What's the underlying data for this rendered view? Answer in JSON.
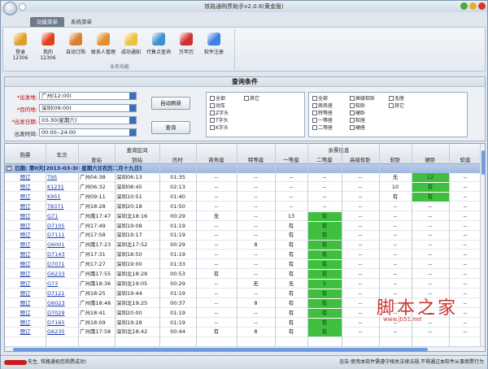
{
  "window": {
    "title": "铁路通购票助手v2.0.8(黄金版)"
  },
  "tabs": [
    "功能菜单",
    "系统菜单"
  ],
  "ribbon": {
    "buttons": [
      {
        "label": "登录12306",
        "icon": "user-login-icon",
        "color": "#e0a030"
      },
      {
        "label": "我的12306",
        "icon": "home-icon",
        "color": "#e04020"
      },
      {
        "label": "自动订购",
        "icon": "people-icon",
        "color": "#d88030"
      },
      {
        "label": "联系人管理",
        "icon": "contact-icon",
        "color": "#e09030"
      },
      {
        "label": "成功通知",
        "icon": "speech-bubble-icon",
        "color": "#f0c040"
      },
      {
        "label": "代售点查询",
        "icon": "search-document-icon",
        "color": "#4090d0"
      },
      {
        "label": "万年历",
        "icon": "calendar-icon",
        "color": "#d03030"
      },
      {
        "label": "软件注册",
        "icon": "flag-icon",
        "color": "#4080e0"
      }
    ],
    "group_label": "业务功能"
  },
  "query": {
    "title": "查询条件",
    "from_label": "*出发地:",
    "from_value": "广州(12:00)",
    "to_label": "*目的地:",
    "to_value": "深圳(09:00)",
    "date_label": "*出发日期:",
    "date_value": "03-30(星期六)",
    "time_label": "出发时间:",
    "time_value": "00:00--24:00",
    "auto_refresh": "自动刷新",
    "query_btn": "查询",
    "train_types": [
      "全部",
      "动车",
      "Z字头",
      "T字头",
      "K字头",
      "其它"
    ],
    "seat_types": [
      "全部",
      "商务座",
      "特等座",
      "一等座",
      "二等座",
      "高级软卧",
      "软卧",
      "硬卧",
      "软座",
      "硬座",
      "无座",
      "其它"
    ]
  },
  "grid": {
    "headers": {
      "buy": "购票",
      "train": "车次",
      "section": "查询区间",
      "from_st": "发站",
      "to_st": "到站",
      "duration": "历时",
      "ticket_info": "余票信息",
      "swz": "商务座",
      "tdz": "特等座",
      "ydz": "一等座",
      "edz": "二等座",
      "gjrw": "高级软卧",
      "rw": "软卧",
      "yw": "硬卧",
      "rz": "软座"
    },
    "group_text": "日期: 第0天[2013-03-30 星期六][农历二月十九日]",
    "green": "#3fbe3f",
    "rows": [
      {
        "buy": "预订",
        "train": "T95",
        "from": "广州04:38",
        "to": "深圳06:13",
        "dur": "01:35",
        "swz": "--",
        "tdz": "--",
        "ydz": "--",
        "edz": "--",
        "gjrw": "--",
        "rw": "无",
        "yw": "12",
        "rz": "--",
        "g": [
          "yw"
        ]
      },
      {
        "buy": "预订",
        "train": "K1231",
        "from": "广州06:32",
        "to": "深圳08:45",
        "dur": "02:13",
        "swz": "--",
        "tdz": "--",
        "ydz": "--",
        "edz": "--",
        "gjrw": "--",
        "rw": "10",
        "yw": "有",
        "rz": "--",
        "g": [
          "yw"
        ]
      },
      {
        "buy": "预订",
        "train": "K951",
        "from": "广州09:11",
        "to": "深圳10:51",
        "dur": "01:40",
        "swz": "--",
        "tdz": "--",
        "ydz": "--",
        "edz": "--",
        "gjrw": "--",
        "rw": "有",
        "yw": "有",
        "rz": "--",
        "g": [
          "yw"
        ]
      },
      {
        "buy": "预订",
        "train": "T8371",
        "from": "广州18:28",
        "to": "深圳20:18",
        "dur": "01:50",
        "swz": "--",
        "tdz": "--",
        "ydz": "--",
        "edz": "--",
        "gjrw": "--",
        "rw": "--",
        "yw": "--",
        "rz": "--",
        "g": []
      },
      {
        "buy": "预订",
        "train": "G71",
        "from": "广州南17:47",
        "to": "深圳北18:16",
        "dur": "00:29",
        "swz": "无",
        "tdz": "--",
        "ydz": "13",
        "edz": "有",
        "gjrw": "--",
        "rw": "--",
        "yw": "--",
        "rz": "--",
        "g": [
          "edz"
        ]
      },
      {
        "buy": "预订",
        "train": "D7105",
        "from": "广州17:49",
        "to": "深圳19:08",
        "dur": "01:19",
        "swz": "--",
        "tdz": "--",
        "ydz": "有",
        "edz": "有",
        "gjrw": "--",
        "rw": "--",
        "yw": "--",
        "rz": "--",
        "g": [
          "edz"
        ]
      },
      {
        "buy": "预订",
        "train": "D7111",
        "from": "广州17:58",
        "to": "深圳19:17",
        "dur": "01:19",
        "swz": "--",
        "tdz": "--",
        "ydz": "有",
        "edz": "有",
        "gjrw": "--",
        "rw": "--",
        "yw": "--",
        "rz": "--",
        "g": [
          "edz"
        ]
      },
      {
        "buy": "预订",
        "train": "G6001",
        "from": "广州南17:23",
        "to": "深圳北17:52",
        "dur": "00:29",
        "swz": "--",
        "tdz": "8",
        "ydz": "有",
        "edz": "有",
        "gjrw": "--",
        "rw": "--",
        "yw": "--",
        "rz": "--",
        "g": [
          "edz"
        ]
      },
      {
        "buy": "预订",
        "train": "D7143",
        "from": "广州17:31",
        "to": "深圳18:50",
        "dur": "01:19",
        "swz": "--",
        "tdz": "--",
        "ydz": "有",
        "edz": "有",
        "gjrw": "--",
        "rw": "--",
        "yw": "--",
        "rz": "--",
        "g": [
          "edz"
        ]
      },
      {
        "buy": "预订",
        "train": "D7071",
        "from": "广州17:27",
        "to": "深圳19:00",
        "dur": "01:33",
        "swz": "--",
        "tdz": "--",
        "ydz": "有",
        "edz": "有",
        "gjrw": "--",
        "rw": "--",
        "yw": "--",
        "rz": "--",
        "g": [
          "edz"
        ]
      },
      {
        "buy": "预订",
        "train": "G6233",
        "from": "广州南17:55",
        "to": "深圳北18:28",
        "dur": "00:53",
        "swz": "有",
        "tdz": "--",
        "ydz": "有",
        "edz": "有",
        "gjrw": "--",
        "rw": "--",
        "yw": "--",
        "rz": "--",
        "g": [
          "edz"
        ]
      },
      {
        "buy": "预订",
        "train": "G73",
        "from": "广州南18:36",
        "to": "深圳北19:05",
        "dur": "00:29",
        "swz": "--",
        "tdz": "无",
        "ydz": "无",
        "edz": "5",
        "gjrw": "--",
        "rw": "--",
        "yw": "--",
        "rz": "--",
        "g": [
          "edz"
        ]
      },
      {
        "buy": "预订",
        "train": "D7121",
        "from": "广州18:25",
        "to": "深圳19:44",
        "dur": "01:19",
        "swz": "--",
        "tdz": "--",
        "ydz": "有",
        "edz": "有",
        "gjrw": "--",
        "rw": "--",
        "yw": "--",
        "rz": "--",
        "g": [
          "edz"
        ]
      },
      {
        "buy": "预订",
        "train": "G6023",
        "from": "广州南18:48",
        "to": "深圳北19:25",
        "dur": "00:37",
        "swz": "--",
        "tdz": "8",
        "ydz": "有",
        "edz": "有",
        "gjrw": "--",
        "rw": "--",
        "yw": "--",
        "rz": "--",
        "g": [
          "edz"
        ]
      },
      {
        "buy": "预订",
        "train": "D7029",
        "from": "广州18:41",
        "to": "深圳20:00",
        "dur": "01:19",
        "swz": "--",
        "tdz": "--",
        "ydz": "有",
        "edz": "有",
        "gjrw": "--",
        "rw": "--",
        "yw": "--",
        "rz": "--",
        "g": [
          "edz"
        ]
      },
      {
        "buy": "预订",
        "train": "D7165",
        "from": "广州18:09",
        "to": "深圳19:28",
        "dur": "01:19",
        "swz": "--",
        "tdz": "--",
        "ydz": "有",
        "edz": "有",
        "gjrw": "--",
        "rw": "--",
        "yw": "--",
        "rz": "--",
        "g": [
          "edz"
        ]
      },
      {
        "buy": "预订",
        "train": "G6235",
        "from": "广州南17:58",
        "to": "深圳北18:42",
        "dur": "00:44",
        "swz": "有",
        "tdz": "8",
        "ydz": "有",
        "edz": "有",
        "gjrw": "--",
        "rw": "--",
        "yw": "--",
        "rz": "--",
        "g": [
          "edz"
        ]
      }
    ]
  },
  "status": {
    "left": "先生, 铁路通祝您购票成功!",
    "right": "忠告:使用本软件需遵守相关法律法规,不得通过本软件从事倒票行为"
  },
  "watermark": {
    "main": "脚本之家",
    "sub": "www.jb51.net"
  }
}
